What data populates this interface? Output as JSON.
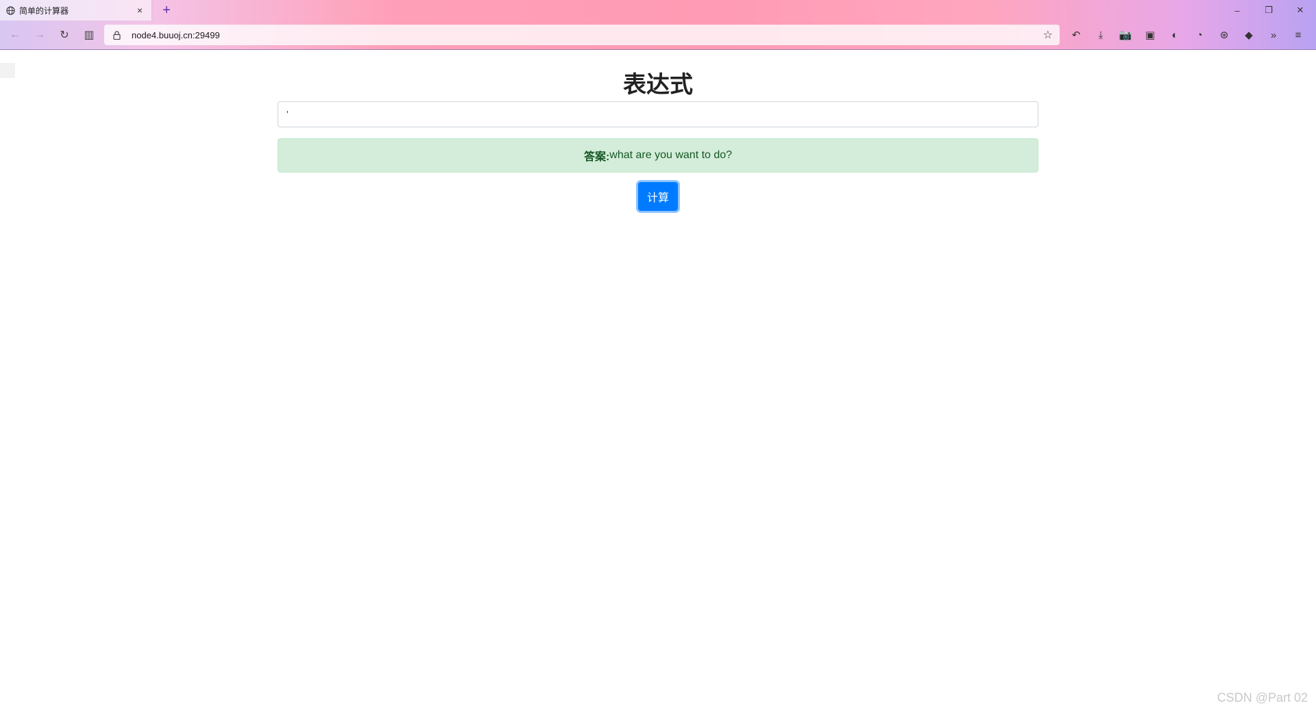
{
  "browser": {
    "tab": {
      "title": "简单的计算器",
      "icon": "globe-icon",
      "close_glyph": "×"
    },
    "new_tab_glyph": "+",
    "window_controls": {
      "minimize": "–",
      "restore": "❐",
      "close": "✕"
    },
    "nav": {
      "back": "←",
      "forward": "→",
      "reload": "↻",
      "sidebar": "▥"
    },
    "address": {
      "url": "node4.buuoj.cn:29499",
      "lock": "🔒",
      "bookmark": "☆"
    },
    "toolbar_icons": [
      {
        "name": "history-back-icon",
        "glyph": "↶"
      },
      {
        "name": "download-icon",
        "glyph": "⤓"
      },
      {
        "name": "screenshot-icon",
        "glyph": "📷"
      },
      {
        "name": "private-mask-icon",
        "glyph": "▣"
      },
      {
        "name": "extension-shield-icon",
        "glyph": "◐"
      },
      {
        "name": "extension-cat-icon",
        "glyph": "◔"
      },
      {
        "name": "extension-ball-icon",
        "glyph": "⊛"
      },
      {
        "name": "extension-diamond-icon",
        "glyph": "◆"
      },
      {
        "name": "overflow-chevron-icon",
        "glyph": "»"
      },
      {
        "name": "menu-hamburger-icon",
        "glyph": "≡"
      }
    ]
  },
  "page": {
    "title": "表达式",
    "input_value": "'",
    "answer_label": "答案:",
    "answer_text": "what are you want to do?",
    "button_label": "计算"
  },
  "watermark": "CSDN @Part 02",
  "colors": {
    "button": "#007bff",
    "alert_bg": "#d4edda",
    "alert_text": "#155724"
  }
}
